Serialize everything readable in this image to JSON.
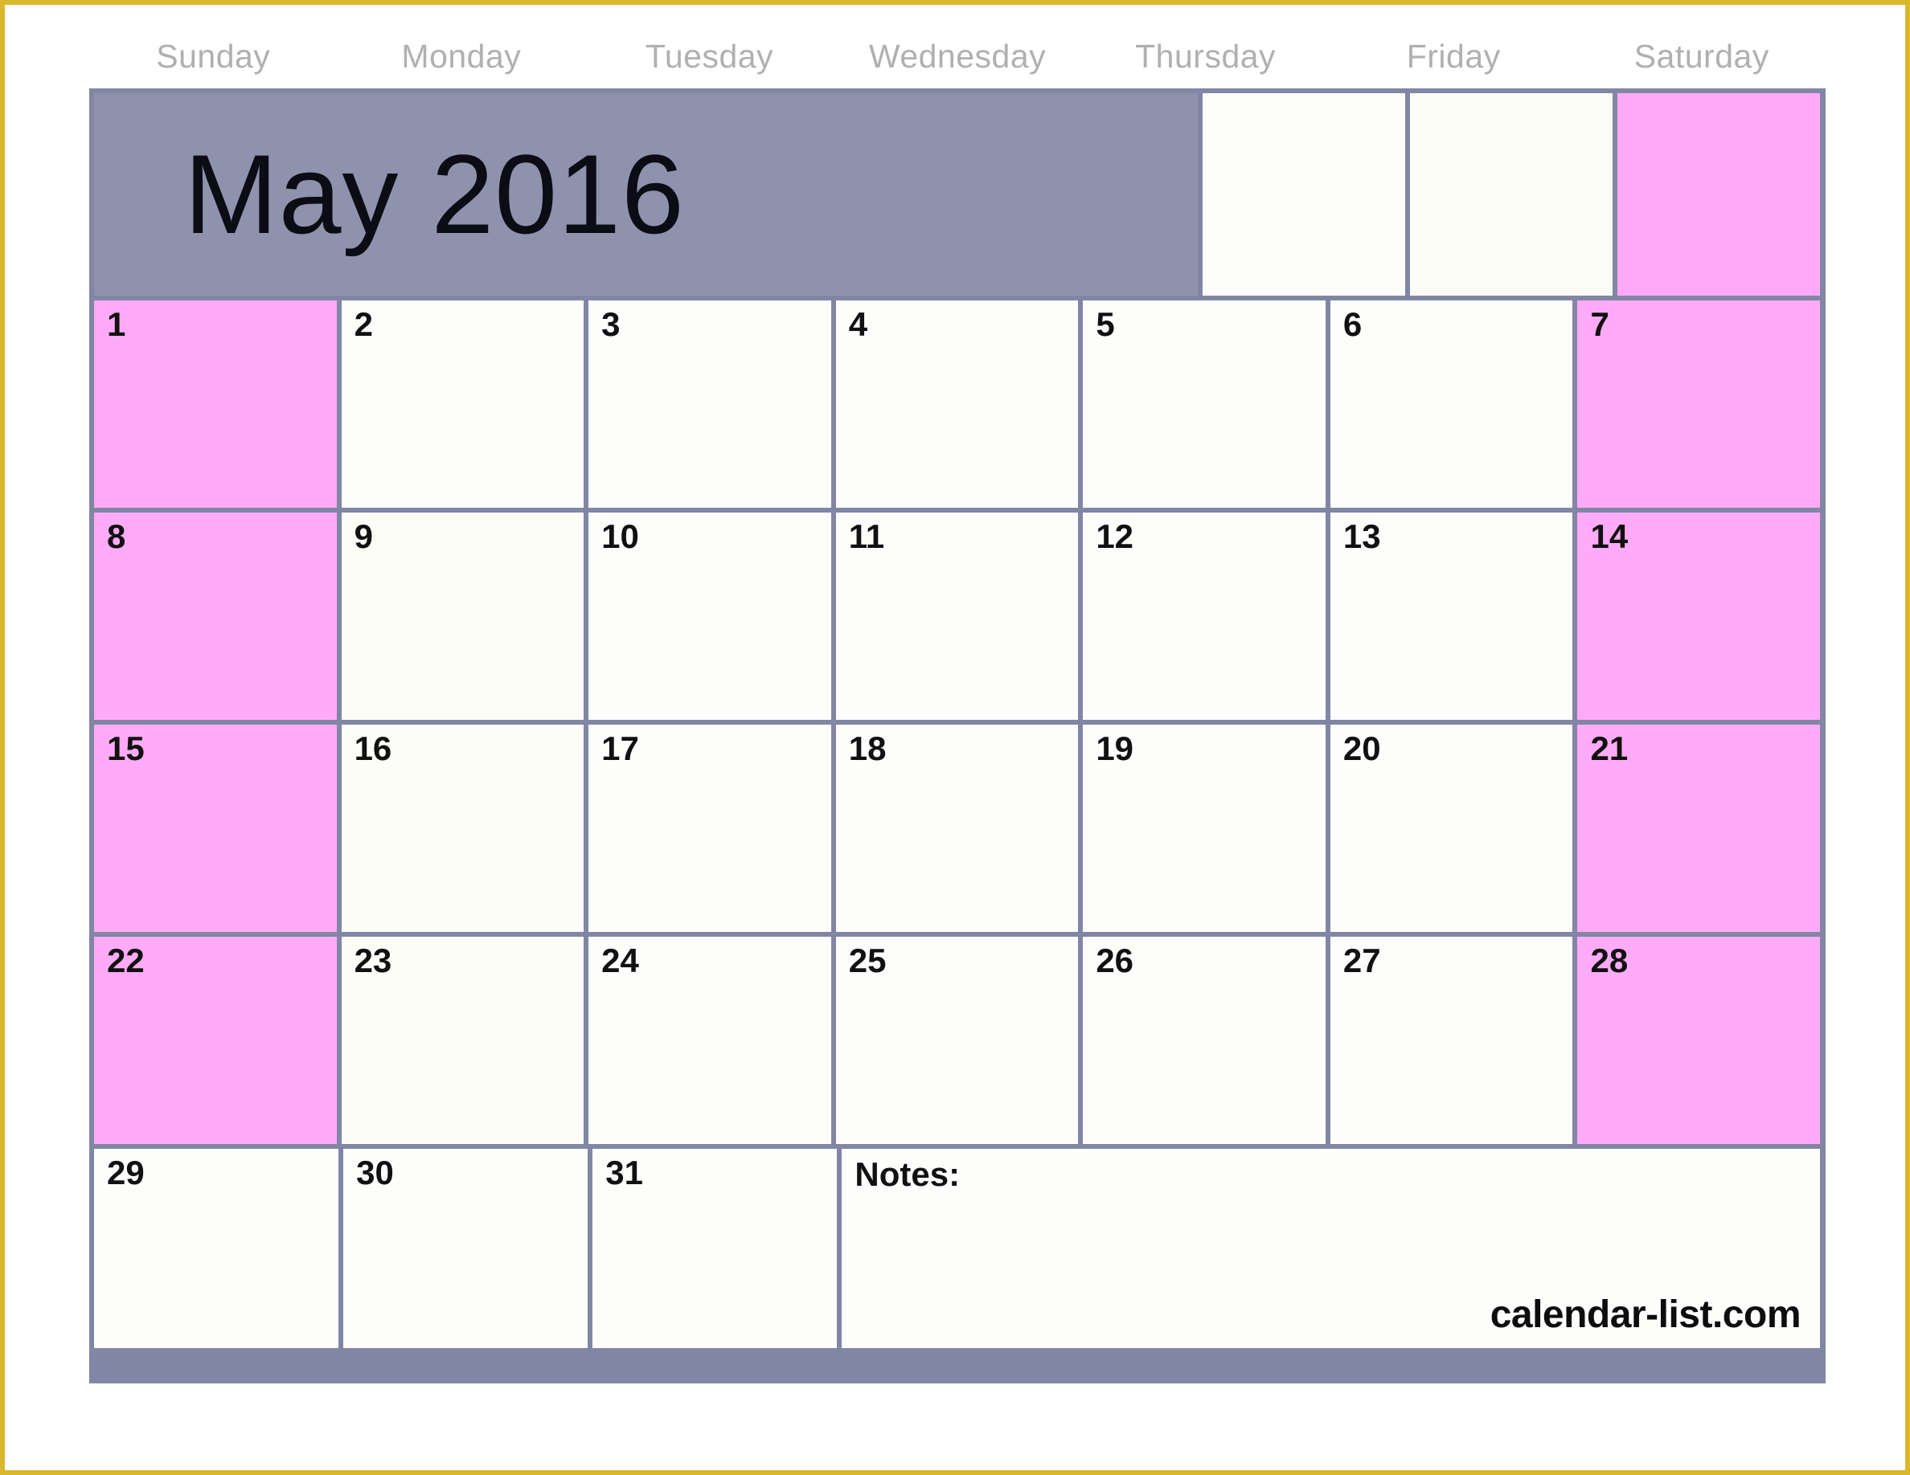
{
  "month_title": "May 2016",
  "weekdays": [
    "Sunday",
    "Monday",
    "Tuesday",
    "Wednesday",
    "Thursday",
    "Friday",
    "Saturday"
  ],
  "notes": {
    "label": "Notes:",
    "credit": "calendar-list.com"
  },
  "watermark": "",
  "colors": {
    "page_border": "#d9b82c",
    "grid_line": "#8286a5",
    "title_banner": "#8f92ad",
    "weekend_pink": "#ffaaf6",
    "cell_white": "#fdfdfb",
    "weekday_label": "#b0b0b0",
    "day_number": "#111111"
  },
  "weeks": [
    {
      "row": 1,
      "days": [
        {
          "num": "1",
          "weekend": true
        },
        {
          "num": "2",
          "weekend": false
        },
        {
          "num": "3",
          "weekend": false
        },
        {
          "num": "4",
          "weekend": false
        },
        {
          "num": "5",
          "weekend": false
        },
        {
          "num": "6",
          "weekend": false
        },
        {
          "num": "7",
          "weekend": true
        }
      ]
    },
    {
      "row": 2,
      "days": [
        {
          "num": "8",
          "weekend": true
        },
        {
          "num": "9",
          "weekend": false
        },
        {
          "num": "10",
          "weekend": false
        },
        {
          "num": "11",
          "weekend": false
        },
        {
          "num": "12",
          "weekend": false
        },
        {
          "num": "13",
          "weekend": false
        },
        {
          "num": "14",
          "weekend": true
        }
      ]
    },
    {
      "row": 3,
      "days": [
        {
          "num": "15",
          "weekend": true
        },
        {
          "num": "16",
          "weekend": false
        },
        {
          "num": "17",
          "weekend": false
        },
        {
          "num": "18",
          "weekend": false
        },
        {
          "num": "19",
          "weekend": false
        },
        {
          "num": "20",
          "weekend": false
        },
        {
          "num": "21",
          "weekend": true
        }
      ]
    },
    {
      "row": 4,
      "days": [
        {
          "num": "22",
          "weekend": true
        },
        {
          "num": "23",
          "weekend": false
        },
        {
          "num": "24",
          "weekend": false
        },
        {
          "num": "25",
          "weekend": false
        },
        {
          "num": "26",
          "weekend": false
        },
        {
          "num": "27",
          "weekend": false
        },
        {
          "num": "28",
          "weekend": true
        }
      ]
    },
    {
      "row": 5,
      "days": [
        {
          "num": "29",
          "weekend": false
        },
        {
          "num": "30",
          "weekend": false
        },
        {
          "num": "31",
          "weekend": false
        }
      ]
    }
  ],
  "title_row_trailing_cells": [
    {
      "kind": "blank-white"
    },
    {
      "kind": "blank-tint"
    },
    {
      "kind": "pink"
    }
  ]
}
